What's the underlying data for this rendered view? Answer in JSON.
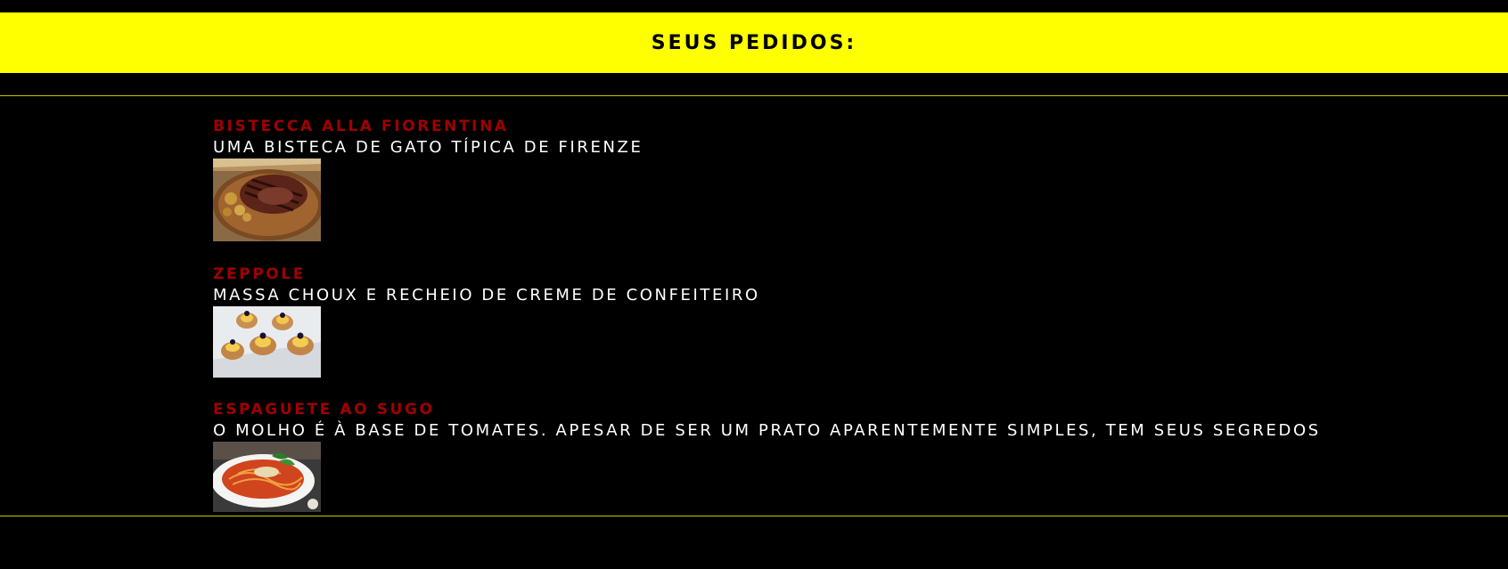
{
  "header": {
    "title": "SEUS PEDIDOS:",
    "background": "#ffff00"
  },
  "colors": {
    "page_background": "#000000",
    "item_name": "#a00000",
    "item_description": "#ffffff",
    "divider": "#c8c800"
  },
  "orders": [
    {
      "name": "BISTECCA ALLA FIORENTINA",
      "description": "UMA BISTECA DE GATO TÍPICA DE FIRENZE",
      "photo": "grilled-steak-photo"
    },
    {
      "name": "ZEPPOLE",
      "description": "MASSA CHOUX E RECHEIO DE CREME DE CONFEITEIRO",
      "photo": "zeppole-pastries-photo"
    },
    {
      "name": "ESPAGUETE AO SUGO",
      "description": "O MOLHO É À BASE DE TOMATES. APESAR DE SER UM PRATO APARENTEMENTE SIMPLES, TEM SEUS SEGREDOS",
      "photo": "spaghetti-sugo-photo"
    }
  ]
}
